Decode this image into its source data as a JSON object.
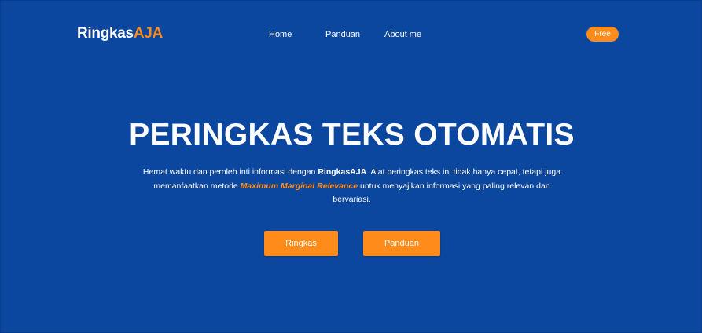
{
  "header": {
    "logo_main": "Ringkas",
    "logo_accent": "AJA",
    "nav": [
      "Home",
      "Panduan",
      "About me"
    ],
    "badge": "Free"
  },
  "hero": {
    "title": "PERINGKAS TEKS OTOMATIS",
    "desc_part1": "Hemat waktu dan peroleh inti informasi dengan ",
    "desc_brand": "RingkasAJA",
    "desc_part2": ". Alat peringkas teks ini tidak hanya cepat, tetapi juga memanfaatkan metode ",
    "desc_method": "Maximum Marginal Relevance",
    "desc_part3": "  untuk menyajikan informasi yang paling relevan dan bervariasi.",
    "buttons": [
      "Ringkas",
      "Panduan"
    ]
  },
  "colors": {
    "background": "#0c479f",
    "accent": "#ff8c1a",
    "text": "#ffffff"
  }
}
